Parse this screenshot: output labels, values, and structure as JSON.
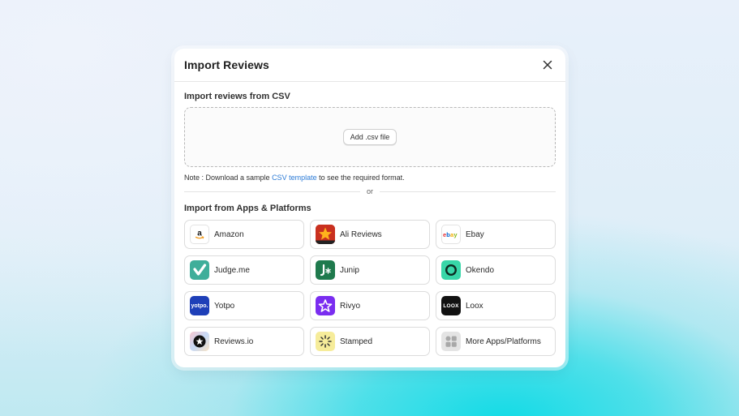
{
  "modal": {
    "title": "Import Reviews",
    "close_icon": "close-icon"
  },
  "csv": {
    "heading": "Import reviews from CSV",
    "add_button": "Add .csv file",
    "note_prefix": "Note : Download a sample ",
    "note_link": "CSV template",
    "note_suffix": " to see the required format."
  },
  "divider": {
    "label": "or"
  },
  "platforms": {
    "heading": "Import from Apps & Platforms",
    "items": [
      {
        "label": "Amazon",
        "icon": "amazon-logo-icon"
      },
      {
        "label": "Ali Reviews",
        "icon": "ali-reviews-logo-icon"
      },
      {
        "label": "Ebay",
        "icon": "ebay-logo-icon",
        "logo_text": "ebay"
      },
      {
        "label": "Judge.me",
        "icon": "judgeme-logo-icon"
      },
      {
        "label": "Junip",
        "icon": "junip-logo-icon"
      },
      {
        "label": "Okendo",
        "icon": "okendo-logo-icon"
      },
      {
        "label": "Yotpo",
        "icon": "yotpo-logo-icon",
        "logo_text": "yotpo."
      },
      {
        "label": "Rivyo",
        "icon": "rivyo-logo-icon"
      },
      {
        "label": "Loox",
        "icon": "loox-logo-icon",
        "logo_text": "LOOX"
      },
      {
        "label": "Reviews.io",
        "icon": "reviewsio-logo-icon"
      },
      {
        "label": "Stamped",
        "icon": "stamped-logo-icon"
      },
      {
        "label": "More Apps/Platforms",
        "icon": "apps-grid-icon"
      }
    ]
  },
  "colors": {
    "link": "#2a7ad6",
    "judgeme": "#3fae9a",
    "junip": "#1f7a4d",
    "okendo": "#38d6a8",
    "yotpo": "#1e3fb8",
    "rivyo": "#7a2df0",
    "loox": "#111111",
    "stamped": "#f6ec9a"
  }
}
